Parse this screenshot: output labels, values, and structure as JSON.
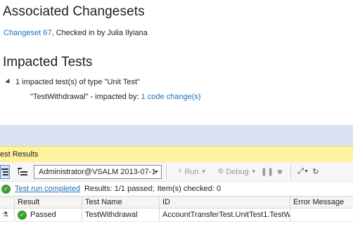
{
  "assoc": {
    "title": "Associated Changesets",
    "changeset_link": "Changeset 67",
    "changeset_rest": ", Checked in by Julia Ilyiana"
  },
  "impacted": {
    "title": "Impacted Tests",
    "summary": "1 impacted test(s) of type \"Unit Test\"",
    "test_label": "\"TestWithdrawal\" - impacted by:",
    "test_link": "1 code change(s)"
  },
  "test_results": {
    "panel_title": "est Results",
    "toolbar": {
      "run_selector": "Administrator@VSALM 2013-07-1",
      "run_label": "Run",
      "debug_label": "Debug"
    },
    "status": {
      "link": "Test run completed",
      "summary": "Results: 1/1 passed;",
      "checked": "Item(s) checked: 0"
    },
    "columns": [
      "Result",
      "Test Name",
      "ID",
      "Error Message"
    ],
    "rows": [
      {
        "result": "Passed",
        "test_name": "TestWithdrawal",
        "id": "AccountTransferTest.UnitTest1.TestW",
        "error": ""
      }
    ]
  },
  "colors": {
    "link": "#1f6fb5",
    "title_bar": "#fff29d",
    "band": "#dbe3f2",
    "pass": "#3a9d2e"
  }
}
